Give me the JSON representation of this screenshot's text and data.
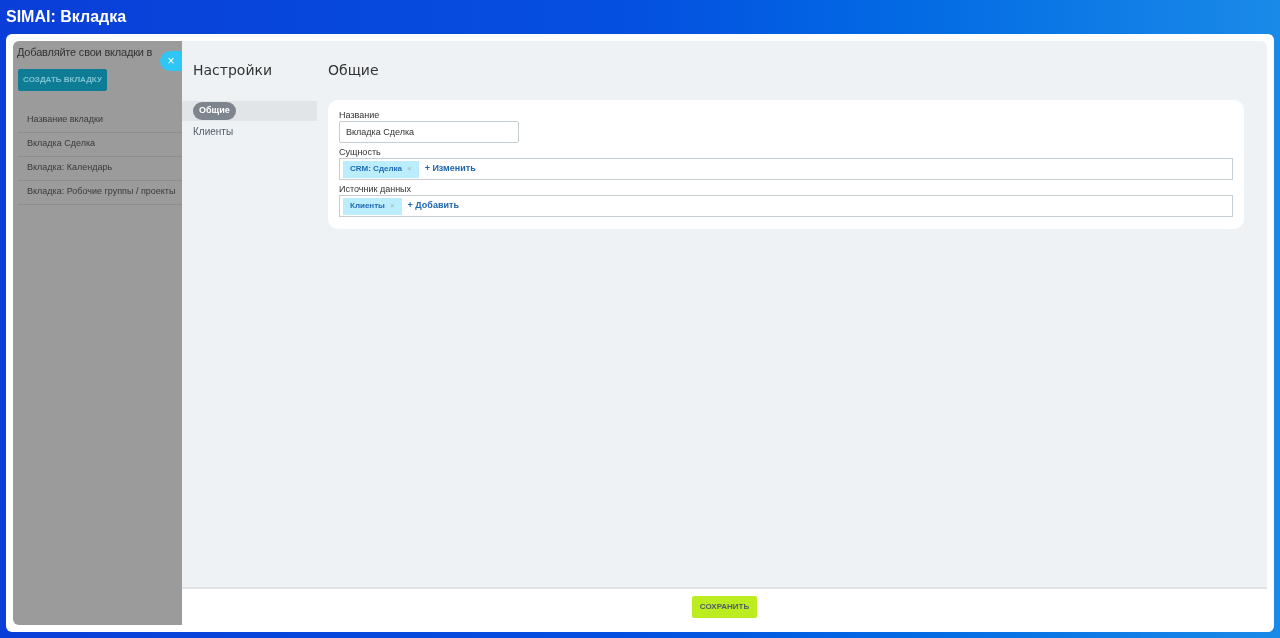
{
  "window": {
    "title": "SIMAI: Вкладка"
  },
  "background_page": {
    "heading": "Добавляйте свои вкладки в",
    "create_button": "СОЗДАТЬ ВКЛАДКУ",
    "rows": [
      "Название вкладки",
      "Вкладка Сделка",
      "Вкладка: Календарь",
      "Вкладка: Робочие группы / проекты"
    ]
  },
  "close_button": "×",
  "settings": {
    "title": "Настройки",
    "nav": [
      {
        "label": "Общие",
        "selected": true
      },
      {
        "label": "Клиенты",
        "selected": false
      }
    ]
  },
  "section": {
    "title": "Общие",
    "fields": [
      {
        "kind": "text",
        "label": "Название",
        "value": "Вкладка Сделка"
      },
      {
        "kind": "tags",
        "label": "Сущность",
        "tags": [
          {
            "label": "CRM: Сделка",
            "remove": "×"
          }
        ],
        "action": "+ Изменить"
      },
      {
        "kind": "tags",
        "label": "Источник данных",
        "tags": [
          {
            "label": "Клиенты",
            "remove": "×"
          }
        ],
        "action": "+ Добавить"
      }
    ]
  },
  "save_button": "СОХРАНИТЬ"
}
